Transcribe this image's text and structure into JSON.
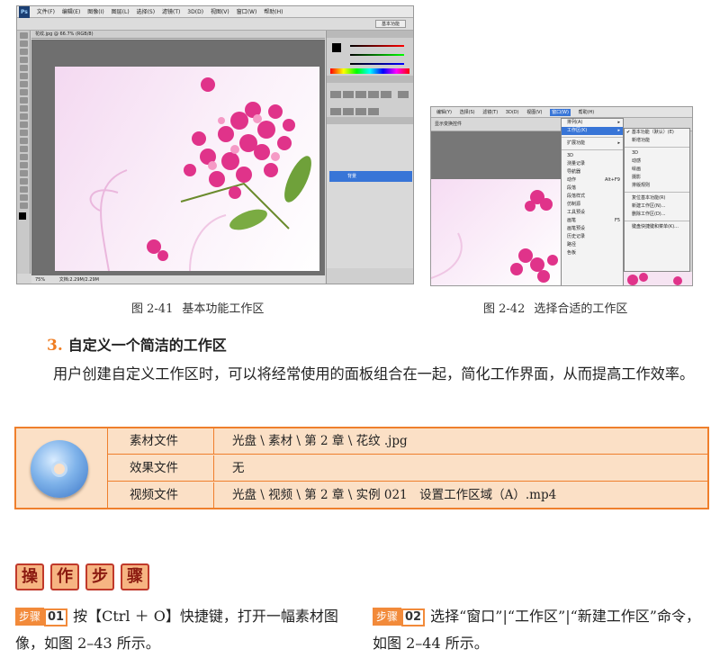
{
  "figure1": {
    "caption_num": "图 2-41",
    "caption_text": "基本功能工作区",
    "menu": [
      "文件(F)",
      "编辑(E)",
      "图像(I)",
      "图层(L)",
      "选择(S)",
      "滤镜(T)",
      "3D(D)",
      "视图(V)",
      "窗口(W)",
      "帮助(H)"
    ],
    "workspace_label": "基本功能",
    "doc_tab": "花纹.jpg @ 66.7% (RGB/8)",
    "zoom": "75%",
    "status": "文档:2.29M/2.29M",
    "layer_name": "背景"
  },
  "figure2": {
    "caption_num": "图 2-42",
    "caption_text": "选择合适的工作区",
    "menu": [
      "编辑(Y)",
      "选择(S)",
      "滤镜(T)",
      "3D(D)",
      "视图(V)",
      "窗口(W)",
      "帮助(H)"
    ],
    "option_label": "显示变换控件",
    "window_menu": [
      {
        "label": "排列(A)",
        "shortcut": ""
      },
      {
        "label": "工作区(K)",
        "shortcut": ""
      },
      {
        "label": "扩展功能",
        "shortcut": ""
      },
      {
        "label": "3D",
        "shortcut": ""
      },
      {
        "label": "测量记录",
        "shortcut": ""
      },
      {
        "label": "导航器",
        "shortcut": ""
      },
      {
        "label": "动作",
        "shortcut": "Alt+F9"
      },
      {
        "label": "段落",
        "shortcut": ""
      },
      {
        "label": "段落样式",
        "shortcut": ""
      },
      {
        "label": "仿制源",
        "shortcut": ""
      },
      {
        "label": "工具预设",
        "shortcut": ""
      },
      {
        "label": "画笔",
        "shortcut": "F5"
      },
      {
        "label": "画笔预设",
        "shortcut": ""
      },
      {
        "label": "历史记录",
        "shortcut": ""
      },
      {
        "label": "路径",
        "shortcut": ""
      },
      {
        "label": "色板",
        "shortcut": ""
      }
    ],
    "submenu": [
      "基本功能（默认）(E)",
      "新增功能",
      "3D",
      "动感",
      "绘画",
      "摄影",
      "排版规则",
      "复位基本功能(R)",
      "新建工作区(N)...",
      "删除工作区(D)...",
      "键盘快捷键和菜单(K)..."
    ]
  },
  "section": {
    "number": "3.",
    "title": "自定义一个简洁的工作区"
  },
  "paragraph": "用户创建自定义工作区时，可以将经常使用的面板组合在一起，简化工作界面，从而提高工作效率。",
  "resources": [
    {
      "key": "素材文件",
      "value": "光盘 \\ 素材 \\ 第 2 章 \\ 花纹 .jpg"
    },
    {
      "key": "效果文件",
      "value": "无"
    },
    {
      "key": "视频文件",
      "value": "光盘 \\ 视频 \\ 第 2 章 \\ 实例 021　设置工作区域（A）.mp4"
    }
  ],
  "steps_heading": [
    "操",
    "作",
    "步",
    "骤"
  ],
  "steps": [
    {
      "tag": "步骤",
      "num": "01",
      "text": "按【Ctrl ＋ O】快捷键，打开一幅素材图像，如图 2–43 所示。"
    },
    {
      "tag": "步骤",
      "num": "02",
      "text": "选择“窗口”|“工作区”|“新建工作区”命令，如图 2–44 所示。"
    }
  ],
  "colors": {
    "accent": "#ef7f2c",
    "table_bg": "#fbe0c6",
    "flower": "#e0338a"
  }
}
